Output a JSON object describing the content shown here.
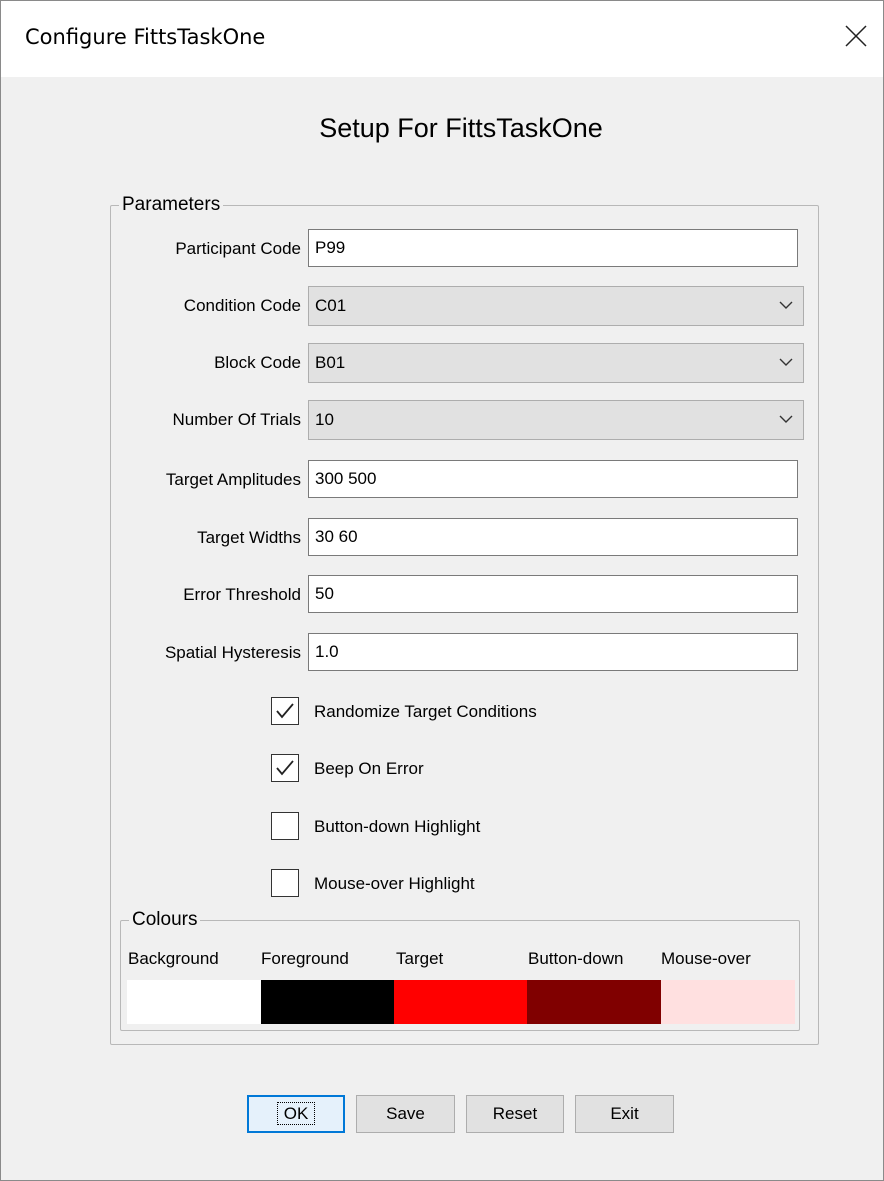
{
  "window": {
    "title": "Configure FittsTaskOne"
  },
  "heading": "Setup For FittsTaskOne",
  "parameters": {
    "legend": "Parameters",
    "participant_code": {
      "label": "Participant Code",
      "value": "P99"
    },
    "condition_code": {
      "label": "Condition Code",
      "value": "C01"
    },
    "block_code": {
      "label": "Block Code",
      "value": "B01"
    },
    "number_of_trials": {
      "label": "Number Of Trials",
      "value": "10"
    },
    "target_amplitudes": {
      "label": "Target Amplitudes",
      "value": "300 500"
    },
    "target_widths": {
      "label": "Target Widths",
      "value": "30 60"
    },
    "error_threshold": {
      "label": "Error Threshold",
      "value": "50"
    },
    "spatial_hysteresis": {
      "label": "Spatial Hysteresis",
      "value": "1.0"
    },
    "checkboxes": [
      {
        "label": "Randomize Target Conditions",
        "checked": true
      },
      {
        "label": "Beep On Error",
        "checked": true
      },
      {
        "label": "Button-down Highlight",
        "checked": false
      },
      {
        "label": "Mouse-over Highlight",
        "checked": false
      }
    ]
  },
  "colours": {
    "legend": "Colours",
    "swatches": [
      {
        "label": "Background",
        "color": "#ffffff"
      },
      {
        "label": "Foreground",
        "color": "#000000"
      },
      {
        "label": "Target",
        "color": "#ff0000"
      },
      {
        "label": "Button-down",
        "color": "#800000"
      },
      {
        "label": "Mouse-over",
        "color": "#ffe0e0"
      }
    ]
  },
  "buttons": {
    "ok": "OK",
    "save": "Save",
    "reset": "Reset",
    "exit": "Exit"
  },
  "icons": {
    "close": "close-icon",
    "dropdown": "chevron-down-icon",
    "check": "checkmark-icon"
  }
}
